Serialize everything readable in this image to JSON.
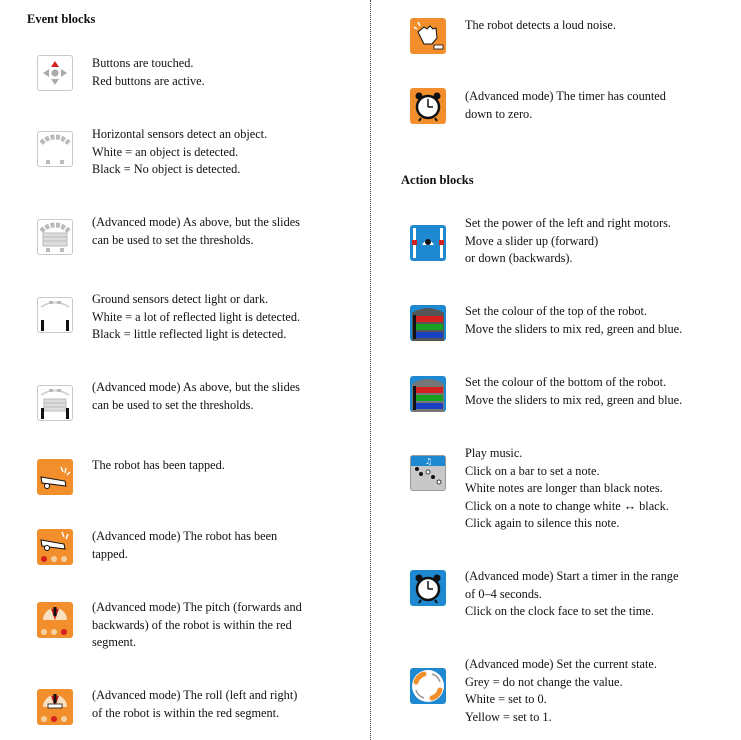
{
  "left_heading": "Event blocks",
  "right_heading": "Action blocks",
  "event_blocks": [
    {
      "icon": "touch-buttons-icon",
      "lines": [
        "Buttons are touched.",
        "Red buttons are active."
      ]
    },
    {
      "icon": "horizontal-sensors-icon",
      "lines": [
        "Horizontal sensors detect an object.",
        "White = an object is detected.",
        "Black = No object is detected."
      ]
    },
    {
      "icon": "horizontal-sensors-advanced-icon",
      "lines": [
        "(Advanced mode) As above, but the slides",
        "can be used to set the thresholds."
      ]
    },
    {
      "icon": "ground-sensors-icon",
      "lines": [
        "Ground sensors detect light or dark.",
        "White = a lot of reflected light is detected.",
        "Black = little reflected light is detected."
      ]
    },
    {
      "icon": "ground-sensors-advanced-icon",
      "lines": [
        "(Advanced mode) As above, but the slides",
        "can be used to set the thresholds."
      ]
    },
    {
      "icon": "tap-icon",
      "lines": [
        "The robot has been tapped."
      ]
    },
    {
      "icon": "tap-advanced-icon",
      "lines": [
        "(Advanced mode) The robot has been",
        "tapped."
      ]
    },
    {
      "icon": "pitch-icon",
      "lines": [
        "(Advanced mode) The pitch (forwards and",
        "backwards) of the robot is within the red",
        "segment."
      ]
    },
    {
      "icon": "roll-icon",
      "lines": [
        "(Advanced mode) The roll (left and right)",
        "of the robot is within the red segment."
      ]
    },
    {
      "icon": "loud-noise-icon",
      "lines": [
        "The robot detects a loud noise."
      ]
    },
    {
      "icon": "timer-alarm-icon",
      "lines": [
        "(Advanced mode) The timer has counted",
        "down to zero."
      ]
    }
  ],
  "action_blocks": [
    {
      "icon": "motors-icon",
      "lines": [
        "Set the power of the left and right motors.",
        "Move a slider up (forward)",
        "or down (backwards)."
      ]
    },
    {
      "icon": "top-colour-icon",
      "lines": [
        "Set the colour of the top of the robot.",
        "Move the sliders to mix red, green and blue."
      ]
    },
    {
      "icon": "bottom-colour-icon",
      "lines": [
        "Set the colour of the bottom of the robot.",
        "Move the sliders to mix red, green and blue."
      ]
    },
    {
      "icon": "music-icon",
      "lines": [
        "Play music.",
        "Click on a bar to set a note.",
        "White notes are longer than black notes.",
        "Click on a note to change white ↔ black.",
        "Click again to silence this note."
      ]
    },
    {
      "icon": "set-timer-icon",
      "lines": [
        "(Advanced mode) Start a timer in the range",
        "of 0–4 seconds.",
        "Click on the clock face to set the time."
      ]
    },
    {
      "icon": "state-icon",
      "lines": [
        "(Advanced mode) Set the current state.",
        "Grey = do not change the value.",
        "White = set to 0.",
        "Yellow = set to 1."
      ]
    }
  ],
  "colors": {
    "orange": "#f28e2b",
    "blue": "#1e88d0",
    "red": "#d62020",
    "green": "#18a020"
  }
}
